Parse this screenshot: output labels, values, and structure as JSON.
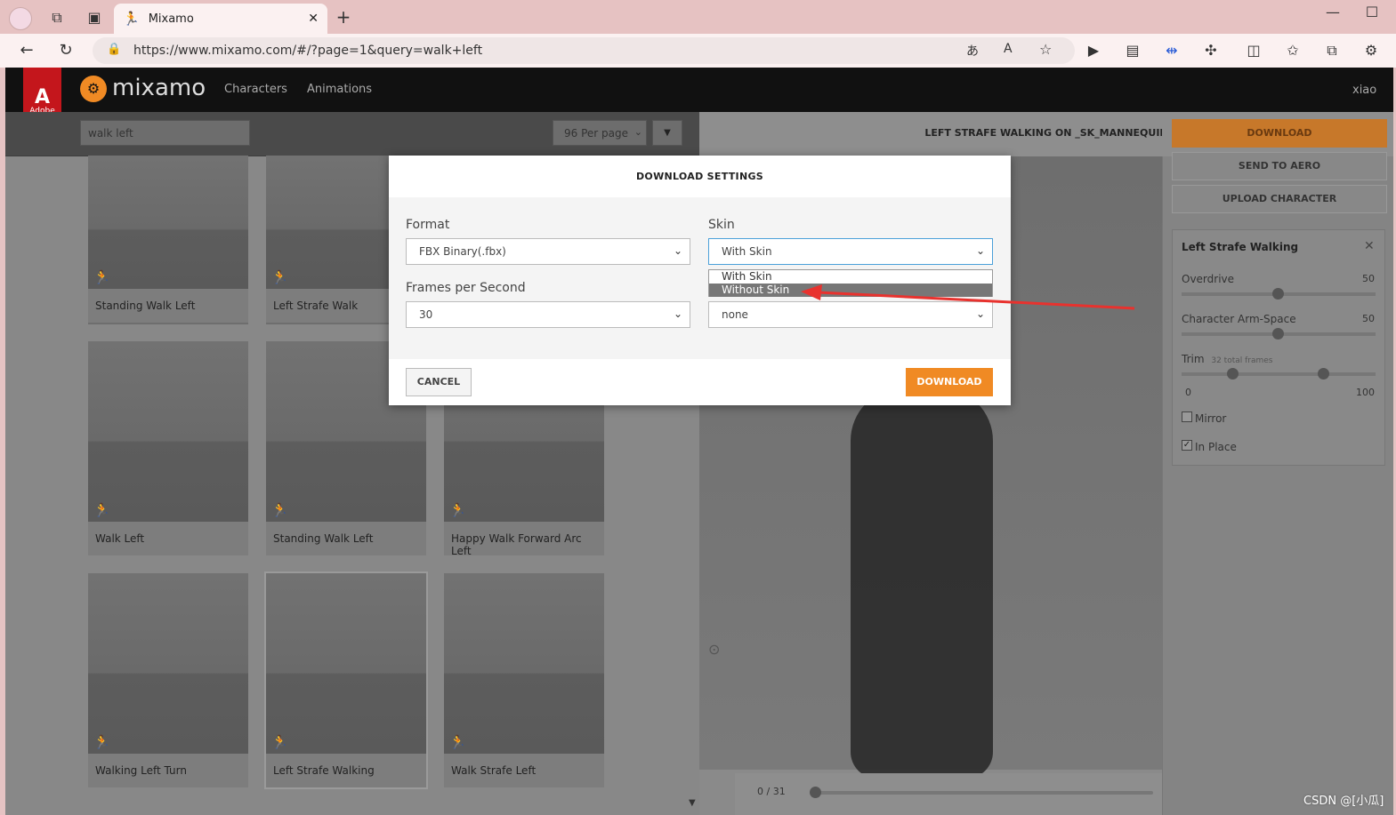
{
  "browser": {
    "tab_title": "Mixamo",
    "url": "https://www.mixamo.com/#/?page=1&query=walk+left"
  },
  "header": {
    "adobe_label": "Adobe",
    "logo_text": "mixamo",
    "nav": [
      "Characters",
      "Animations"
    ],
    "user": "xiao"
  },
  "search": {
    "value": "walk left",
    "per_page": "96 Per page"
  },
  "viewer": {
    "title": "LEFT STRAFE WALKING ON _SK_MANNEQUIN",
    "frame_counter": "0 / 31"
  },
  "cards": [
    {
      "label": "Standing Walk Left"
    },
    {
      "label": "Left Strafe Walk"
    },
    {
      "label": "Walk Left"
    },
    {
      "label": "Standing Walk Left"
    },
    {
      "label": "Happy Walk Forward Arc Left"
    },
    {
      "label": "Walking Left Turn"
    },
    {
      "label": "Left Strafe Walking"
    },
    {
      "label": "Walk Strafe Left"
    }
  ],
  "right_panel": {
    "download": "DOWNLOAD",
    "send_to_aero": "SEND TO AERO",
    "upload_character": "UPLOAD CHARACTER",
    "anim_title": "Left Strafe Walking",
    "overdrive_label": "Overdrive",
    "overdrive_value": "50",
    "arm_space_label": "Character Arm-Space",
    "arm_space_value": "50",
    "trim_label": "Trim",
    "trim_sub": "32 total frames",
    "trim_min": "0",
    "trim_max": "100",
    "mirror_label": "Mirror",
    "in_place_label": "In Place"
  },
  "modal": {
    "title": "DOWNLOAD SETTINGS",
    "format_label": "Format",
    "format_value": "FBX Binary(.fbx)",
    "skin_label": "Skin",
    "skin_value": "With Skin",
    "fps_label": "Frames per Second",
    "fps_value": "30",
    "keyframe_value": "none",
    "skin_options": [
      "With Skin",
      "Without Skin"
    ],
    "cancel": "CANCEL",
    "download": "DOWNLOAD"
  },
  "watermark": "CSDN @[小瓜]",
  "colors": {
    "accent": "#f08a24",
    "header_bg": "#111111",
    "adobe_red": "#c4161c",
    "annotation_arrow": "#e8322e"
  }
}
